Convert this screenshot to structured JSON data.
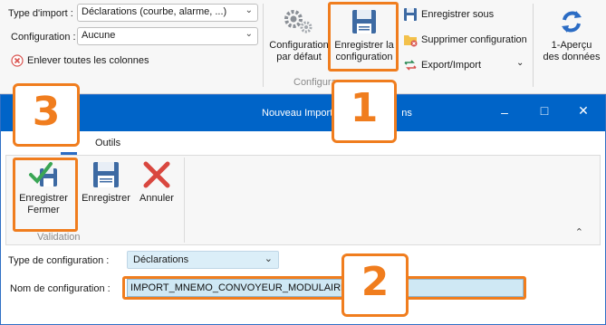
{
  "ribbon": {
    "import_type_label": "Type d'import :",
    "import_type_value": "Déclarations (courbe, alarme, ...)",
    "configuration_label": "Configuration :",
    "configuration_value": "Aucune",
    "remove_columns": "Enlever toutes les colonnes",
    "default_config_line1": "Configuration",
    "default_config_line2": "par défaut",
    "save_config_line1": "Enregistrer la",
    "save_config_line2": "configuration",
    "save_as": "Enregistrer sous",
    "delete_config": "Supprimer configuration",
    "export_import": "Export/Import",
    "group_label": "Configura",
    "preview_line1": "1-Aperçu",
    "preview_line2": "des données"
  },
  "dialog": {
    "title": "Nouveau Import",
    "title_suffix": "ns",
    "tabs": [
      "Outils"
    ],
    "save_close_line1": "Enregistrer",
    "save_close_line2": "Fermer",
    "save": "Enregistrer",
    "cancel": "Annuler",
    "group_label": "Validation",
    "config_type_label": "Type de configuration :",
    "config_type_value": "Déclarations",
    "config_name_label": "Nom de configuration :",
    "config_name_value": "IMPORT_MNEMO_CONVOYEUR_MODULAIRE"
  },
  "callouts": [
    "1",
    "2",
    "3"
  ],
  "colors": {
    "highlight": "#f07d1e",
    "titlebar": "#0064c8",
    "field_bg": "#cfe8f4",
    "select_bg": "#dbeef8"
  }
}
